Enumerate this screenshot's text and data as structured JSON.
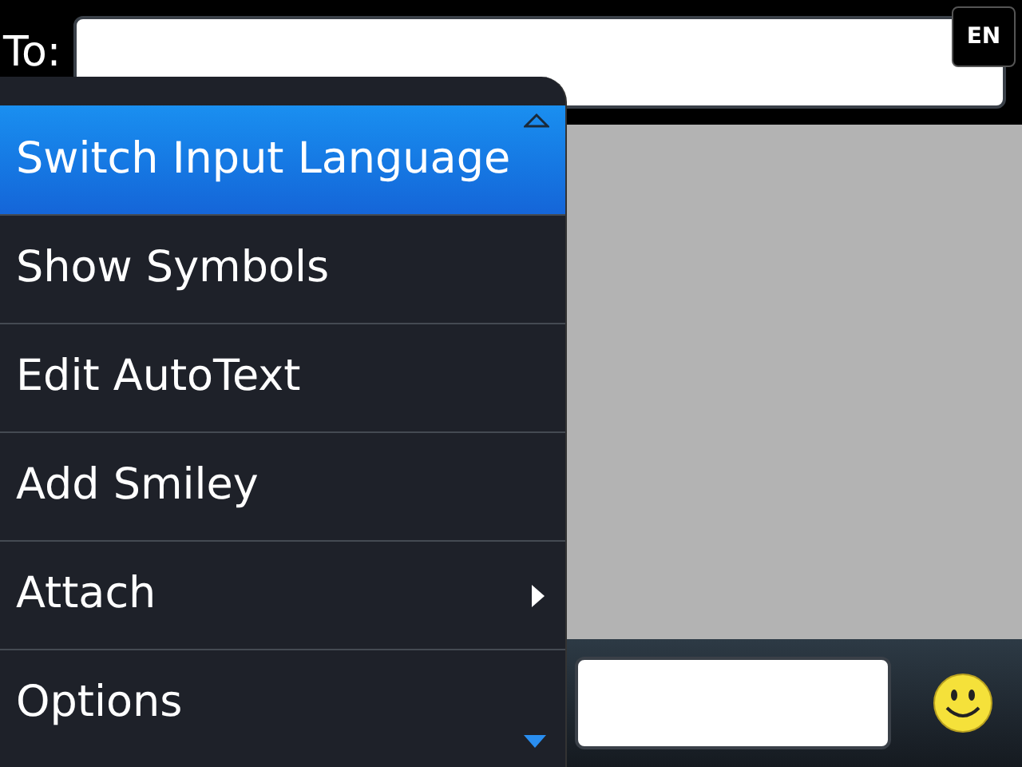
{
  "recipient": {
    "label": "To:"
  },
  "input_language": {
    "badge": "EN"
  },
  "menu": {
    "items": [
      {
        "label": "Switch Input Language",
        "selected": true,
        "has_submenu": false
      },
      {
        "label": "Show Symbols",
        "selected": false,
        "has_submenu": false
      },
      {
        "label": "Edit AutoText",
        "selected": false,
        "has_submenu": false
      },
      {
        "label": "Add Smiley",
        "selected": false,
        "has_submenu": false
      },
      {
        "label": "Attach",
        "selected": false,
        "has_submenu": true
      },
      {
        "label": "Options",
        "selected": false,
        "has_submenu": false
      }
    ]
  }
}
